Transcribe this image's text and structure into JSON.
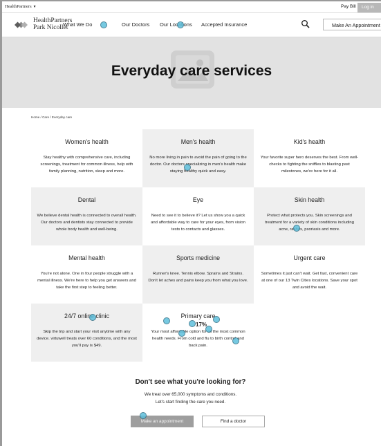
{
  "utility": {
    "brand": "HealthPartners",
    "pay_bill": "Pay Bill",
    "log_in": "Log in"
  },
  "nav": {
    "logo_line1": "HealthPartners",
    "logo_line2": "Park Nicollet",
    "links": [
      "What We Do",
      "Our Doctors",
      "Our Locations",
      "Accepted Insurance"
    ],
    "search_icon": "search-icon",
    "cta": "Make An Appointment"
  },
  "hero": {
    "title": "Everyday care services",
    "image_icon": "image-placeholder-icon",
    "background": "#e2e2e2"
  },
  "breadcrumb": "Home / Care / Everyday care",
  "cards": [
    {
      "title": "Women's health",
      "desc": "Stay healthy with comprehensive care, including screenings, treatment for common illness, help with family planning, nutrition, sleep and more."
    },
    {
      "title": "Men's health",
      "desc": "No more living in pain to avoid the pain of going to the doctor. Our doctors specializing in men's health make staying healthy quick and easy."
    },
    {
      "title": "Kid's health",
      "desc": "Your favorite super hero deserves the best. From well-checks to fighting the sniffles to blasting past milestones, we're here for it all."
    },
    {
      "title": "Dental",
      "desc": "We believe dental health is connected to overall health. Our doctors and dentists stay connected to provide whole body health and well-being."
    },
    {
      "title": "Eye",
      "desc": "Need to see it to believe it? Let us show you a quick and affordable way to care for your eyes, from vision tests to contacts and glasses."
    },
    {
      "title": "Skin health",
      "desc": "Protect what protects you. Skin screenings and treatment for a variety of skin conditions including acne, rashes, psoriasis and more."
    },
    {
      "title": "Mental health",
      "desc": "You're not alone. One in four people struggle with a mental illness. We're here to help you get answers and take the first step to feeling better."
    },
    {
      "title": "Sports medicine",
      "desc": "Runner's knee. Tennis elbow. Sprains and Strains. Don't let aches and pains keep you from what you love."
    },
    {
      "title": "Urgent care",
      "desc": "Sometimes it just can't wait. Get fast, convenient care at one of our 13 Twin Cities locations. Save your spot and avoid the wait."
    },
    {
      "title": "24/7 online clinic",
      "desc": "Skip the trip and start your visit anytime with any device. virtuwell treats over 60 conditions, and the most you'll pay is $49."
    },
    {
      "title": "Primary care",
      "desc": "Your most affordable option for all the most common health needs. From cold and flu to birth control and back pain."
    }
  ],
  "bottom": {
    "heading": "Don't see what you're looking for?",
    "line1": "We treat over 65,000 symptoms and conditions.",
    "line2": "Let's start finding the care you need.",
    "primary_button": "Make an appointment",
    "secondary_button": "Find a doctor"
  },
  "overlay": {
    "marker_color": "#5fc0dc",
    "percent_label": "17%"
  }
}
